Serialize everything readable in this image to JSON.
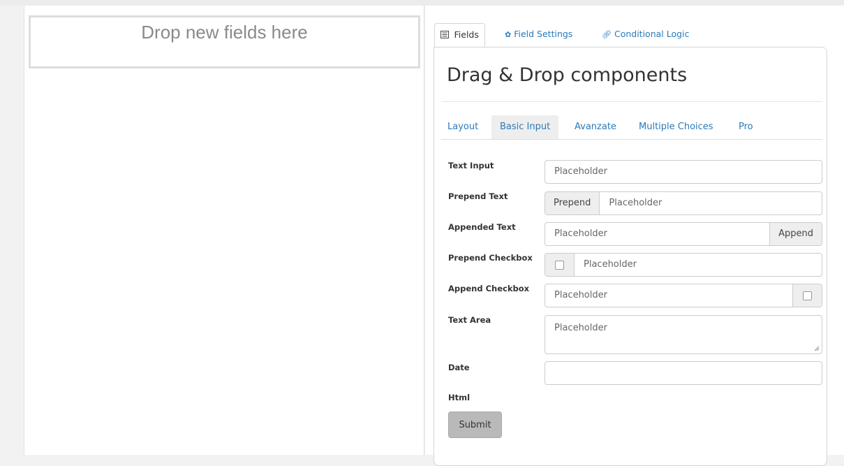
{
  "drop_zone": {
    "text": "Drop new fields here"
  },
  "top_tabs": [
    {
      "label": "Fields",
      "icon": "list-icon"
    },
    {
      "label": "Field Settings",
      "icon": "gear-icon"
    },
    {
      "label": "Conditional Logic",
      "icon": "link-icon"
    }
  ],
  "panel": {
    "title": "Drag & Drop components"
  },
  "sub_tabs": [
    "Layout",
    "Basic Input",
    "Avanzate",
    "Multiple Choices",
    "Pro"
  ],
  "fields": {
    "text_input": {
      "label": "Text Input",
      "placeholder": "Placeholder"
    },
    "prepend_text": {
      "label": "Prepend Text",
      "addon": "Prepend",
      "placeholder": "Placeholder"
    },
    "appended_text": {
      "label": "Appended Text",
      "addon": "Append",
      "placeholder": "Placeholder"
    },
    "prepend_checkbox": {
      "label": "Prepend Checkbox",
      "placeholder": "Placeholder"
    },
    "append_checkbox": {
      "label": "Append Checkbox",
      "placeholder": "Placeholder"
    },
    "text_area": {
      "label": "Text Area",
      "placeholder": "Placeholder"
    },
    "date": {
      "label": "Date"
    },
    "html": {
      "label": "Html"
    }
  },
  "submit_label": "Submit",
  "colors": {
    "link": "#2a7ab9",
    "border": "#cccccc",
    "addon_bg": "#eeeeee",
    "button_bg": "#b9b9b9"
  }
}
